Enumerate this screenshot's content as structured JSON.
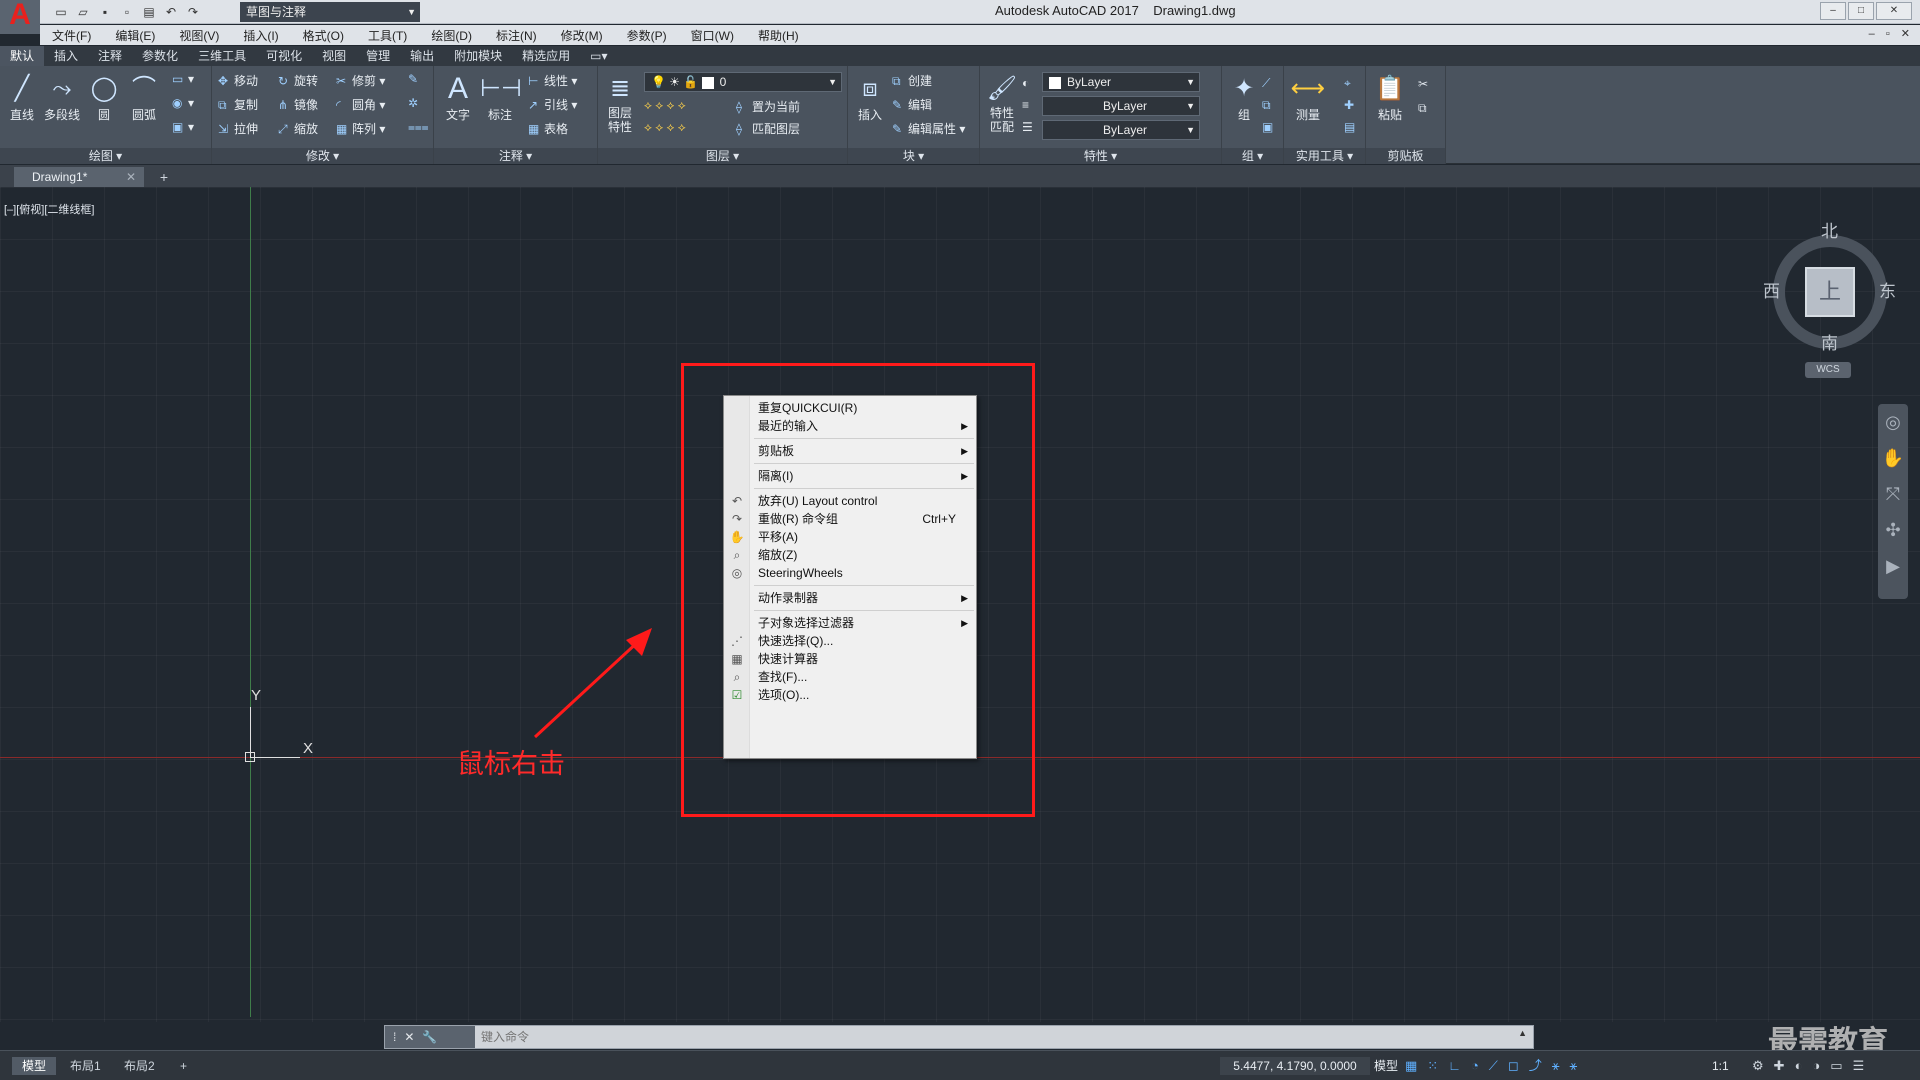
{
  "app": {
    "logo": "A",
    "title": "Autodesk AutoCAD 2017    Drawing1.dwg",
    "workspace": "草图与注释",
    "window_buttons": [
      "–",
      "□",
      "✕"
    ]
  },
  "menubar": [
    "文件(F)",
    "编辑(E)",
    "视图(V)",
    "插入(I)",
    "格式(O)",
    "工具(T)",
    "绘图(D)",
    "标注(N)",
    "修改(M)",
    "参数(P)",
    "窗口(W)",
    "帮助(H)"
  ],
  "ribbon_tabs": [
    "默认",
    "插入",
    "注释",
    "参数化",
    "三维工具",
    "可视化",
    "视图",
    "管理",
    "输出",
    "附加模块",
    "精选应用"
  ],
  "ribbon": {
    "draw": {
      "title": "绘图 ▾",
      "line": "直线",
      "polyline": "多段线",
      "circle": "圆",
      "arc": "圆弧"
    },
    "modify": {
      "title": "修改 ▾",
      "move": "移动",
      "rotate": "旋转",
      "trim": "修剪",
      "copy": "复制",
      "mirror": "镜像",
      "fillet": "圆角",
      "stretch": "拉伸",
      "scale": "缩放",
      "array": "阵列"
    },
    "annotation": {
      "title": "注释 ▾",
      "text": "文字",
      "dimension": "标注",
      "linear": "线性",
      "leader": "引线",
      "table": "表格"
    },
    "layers": {
      "title": "图层 ▾",
      "layer_props": "图层\n特性",
      "current_layer": "0",
      "set_current": "置为当前",
      "match_layer": "匹配图层"
    },
    "block": {
      "title": "块 ▾",
      "insert": "插入",
      "create": "创建",
      "edit": "编辑",
      "edit_attr": "编辑属性"
    },
    "properties": {
      "title": "特性 ▾",
      "match": "特性\n匹配",
      "color": "ByLayer",
      "linetype": "ByLayer",
      "lineweight": "ByLayer"
    },
    "groups": {
      "title": "组 ▾",
      "group": "组"
    },
    "utilities": {
      "title": "实用工具 ▾",
      "measure": "测量"
    },
    "clipboard": {
      "title": "剪贴板",
      "paste": "粘贴"
    }
  },
  "doc_tab": {
    "label": "Drawing1*",
    "close": "✕",
    "add": "+"
  },
  "viewport_label": "[–][俯视][二维线框]",
  "ucs": {
    "x": "X",
    "y": "Y"
  },
  "viewcube": {
    "top": "上",
    "north": "北",
    "south": "南",
    "west": "西",
    "east": "东",
    "wcs": "WCS"
  },
  "context_menu": [
    {
      "label": "重复QUICKCUI(R)",
      "icon": "",
      "shortcut": "",
      "submenu": false
    },
    {
      "label": "最近的输入",
      "icon": "",
      "shortcut": "",
      "submenu": true
    },
    {
      "label": "剪贴板",
      "icon": "",
      "shortcut": "",
      "submenu": true
    },
    {
      "label": "隔离(I)",
      "icon": "",
      "shortcut": "",
      "submenu": true
    },
    {
      "label": "放弃(U) Layout control",
      "icon": "undo-icon",
      "shortcut": "",
      "submenu": false
    },
    {
      "label": "重做(R) 命令组",
      "icon": "redo-icon",
      "shortcut": "Ctrl+Y",
      "submenu": false
    },
    {
      "label": "平移(A)",
      "icon": "pan-icon",
      "shortcut": "",
      "submenu": false
    },
    {
      "label": "缩放(Z)",
      "icon": "zoom-icon",
      "shortcut": "",
      "submenu": false
    },
    {
      "label": "SteeringWheels",
      "icon": "steeringwheel-icon",
      "shortcut": "",
      "submenu": false
    },
    {
      "label": "动作录制器",
      "icon": "",
      "shortcut": "",
      "submenu": true
    },
    {
      "label": "子对象选择过滤器",
      "icon": "",
      "shortcut": "",
      "submenu": true
    },
    {
      "label": "快速选择(Q)...",
      "icon": "quickselect-icon",
      "shortcut": "",
      "submenu": false
    },
    {
      "label": "快速计算器",
      "icon": "calculator-icon",
      "shortcut": "",
      "submenu": false
    },
    {
      "label": "查找(F)...",
      "icon": "find-icon",
      "shortcut": "",
      "submenu": false
    },
    {
      "label": "选项(O)...",
      "icon": "options-icon",
      "shortcut": "",
      "submenu": false
    }
  ],
  "annotation": {
    "text": "鼠标右击",
    "color": "#ff2a2a"
  },
  "command_line": {
    "placeholder": "键入命令"
  },
  "statusbar": {
    "layouts": [
      "模型",
      "布局1",
      "布局2"
    ],
    "add_layout": "+",
    "coordinates": "5.4477, 4.1790, 0.0000",
    "model": "模型",
    "scale": "1:1"
  },
  "watermark": "最需教育",
  "colors": {
    "accent": "#ff1a1a",
    "canvas": "#212830",
    "ribbon": "#4a535e"
  }
}
